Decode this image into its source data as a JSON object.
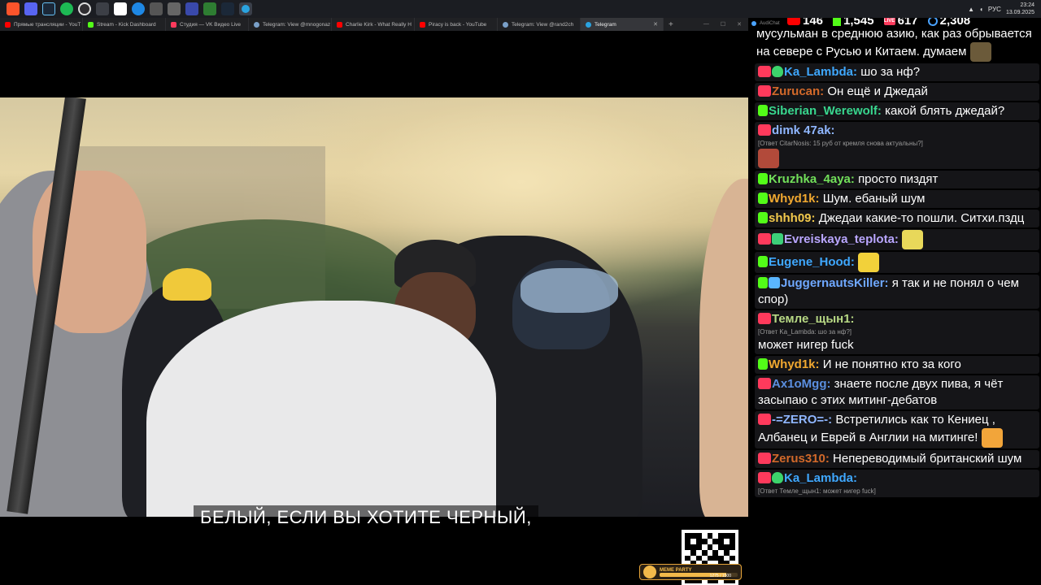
{
  "taskbar": {
    "icons": [
      "brave-icon",
      "discord-icon",
      "steam-icon",
      "spotify-icon",
      "obs-icon",
      "unity-icon",
      "capture-icon",
      "tool-icon",
      "tool-icon",
      "app-icon",
      "app-icon",
      "steam-icon",
      "telegram-icon"
    ],
    "tray_lang": "РУС",
    "time": "23:24",
    "date": "13.09.2025"
  },
  "browser": {
    "tabs": [
      {
        "label": "Прямые трансляции - YouT",
        "color": "#ff0000"
      },
      {
        "label": "Stream - Kick Dashboard",
        "color": "#53fc18"
      },
      {
        "label": "Студия — VK Видео Live",
        "color": "#ff3a5c"
      },
      {
        "label": "Telegram: View @mnogonaz",
        "color": "#7aa0c8"
      },
      {
        "label": "Charlie Kirk - What Really H",
        "color": "#ff0000"
      },
      {
        "label": "Piracy is back - YouTube",
        "color": "#ff0000"
      },
      {
        "label": "Telegram: View @rand2ch",
        "color": "#7aa0c8"
      },
      {
        "label": "Telegram",
        "color": "#2aa3e0"
      }
    ]
  },
  "video": {
    "subtitle": "БЕЛЫЙ, ЕСЛИ ВЫ ХОТИТЕ ЧЕРНЫЙ,",
    "meme_title": "MEME PARTY",
    "meme_value": "1275 / 1500",
    "meme_progress": 0.85
  },
  "chat": {
    "header_label": "AudiChat",
    "stats": {
      "youtube": "146",
      "kick": "1,545",
      "vk": "617",
      "viewers": "2,308"
    },
    "messages": [
      {
        "plain": true,
        "text": "мусульман в среднюю азию, как раз обрывается на севере с Русью и Китаем. думаем",
        "emote": true
      },
      {
        "badges": [
          "vk",
          "shield"
        ],
        "nick": "Ka_Lambda:",
        "color": "#3fa8ff",
        "text": "шо за нф?"
      },
      {
        "badges": [
          "vk"
        ],
        "nick": "Zurucan:",
        "color": "#d2692a",
        "text": "Он ещё и Джедай"
      },
      {
        "badges": [
          "kick"
        ],
        "nick": "Siberian_Werewolf:",
        "color": "#38d68e",
        "text": "какой блять джедай?"
      },
      {
        "badges": [
          "vk"
        ],
        "nick": "dimk 47ak:",
        "color": "#8fb6ff",
        "text": "",
        "reply": "[Ответ CitarNosis: 15 руб от кремля снова актуальны?]",
        "emote": true
      },
      {
        "badges": [
          "kick"
        ],
        "nick": "Kruzhka_4aya:",
        "color": "#72e05a",
        "text": "просто пиздят"
      },
      {
        "badges": [
          "kick"
        ],
        "nick": "Whyd1k:",
        "color": "#f0a830",
        "text": "Шум. ебаный шум"
      },
      {
        "badges": [
          "kick"
        ],
        "nick": "shhh09:",
        "color": "#f2c94c",
        "text": "Джедаи какие-то пошли. Ситхи.пздц"
      },
      {
        "badges": [
          "vk",
          "pen"
        ],
        "nick": "Evreiskaya_teplota:",
        "color": "#b9a6ff",
        "text": "",
        "emote": true
      },
      {
        "badges": [
          "kick"
        ],
        "nick": "Eugene_Hood:",
        "color": "#3fa8ff",
        "text": "",
        "emote": true
      },
      {
        "badges": [
          "kick",
          "rocket"
        ],
        "nick": "JuggernautsKiller:",
        "color": "#6fa8ff",
        "text": "я так и не понял о чем спор)"
      },
      {
        "badges": [
          "vk"
        ],
        "nick": "Темле_щын1:",
        "color": "#b7d884",
        "text": "",
        "reply": "[Ответ Ka_Lambda: шо за нф?]",
        "text2": "может нигер fuck"
      },
      {
        "badges": [
          "kick"
        ],
        "nick": "Whyd1k:",
        "color": "#f0a830",
        "text": "И не понятно кто за кого"
      },
      {
        "badges": [
          "vk"
        ],
        "nick": "Ax1oMgg:",
        "color": "#5b8fe0",
        "text": "знаете после двух пива, я чёт засыпаю с этих митинг-дебатов"
      },
      {
        "badges": [
          "vk"
        ],
        "nick": "-=ZERO=-:",
        "color": "#8fb6ff",
        "text": "Встретились как то Кениец , Албанец и Еврей в Англии на митинге!",
        "emote": true
      },
      {
        "badges": [
          "vk"
        ],
        "nick": "Zerus310:",
        "color": "#d2692a",
        "text": "Непереводимый британский шум"
      },
      {
        "badges": [
          "vk",
          "shield"
        ],
        "nick": "Ka_Lambda:",
        "color": "#3fa8ff",
        "text": "",
        "reply": "[Ответ Темле_щын1: может нигер fuck]"
      }
    ]
  }
}
